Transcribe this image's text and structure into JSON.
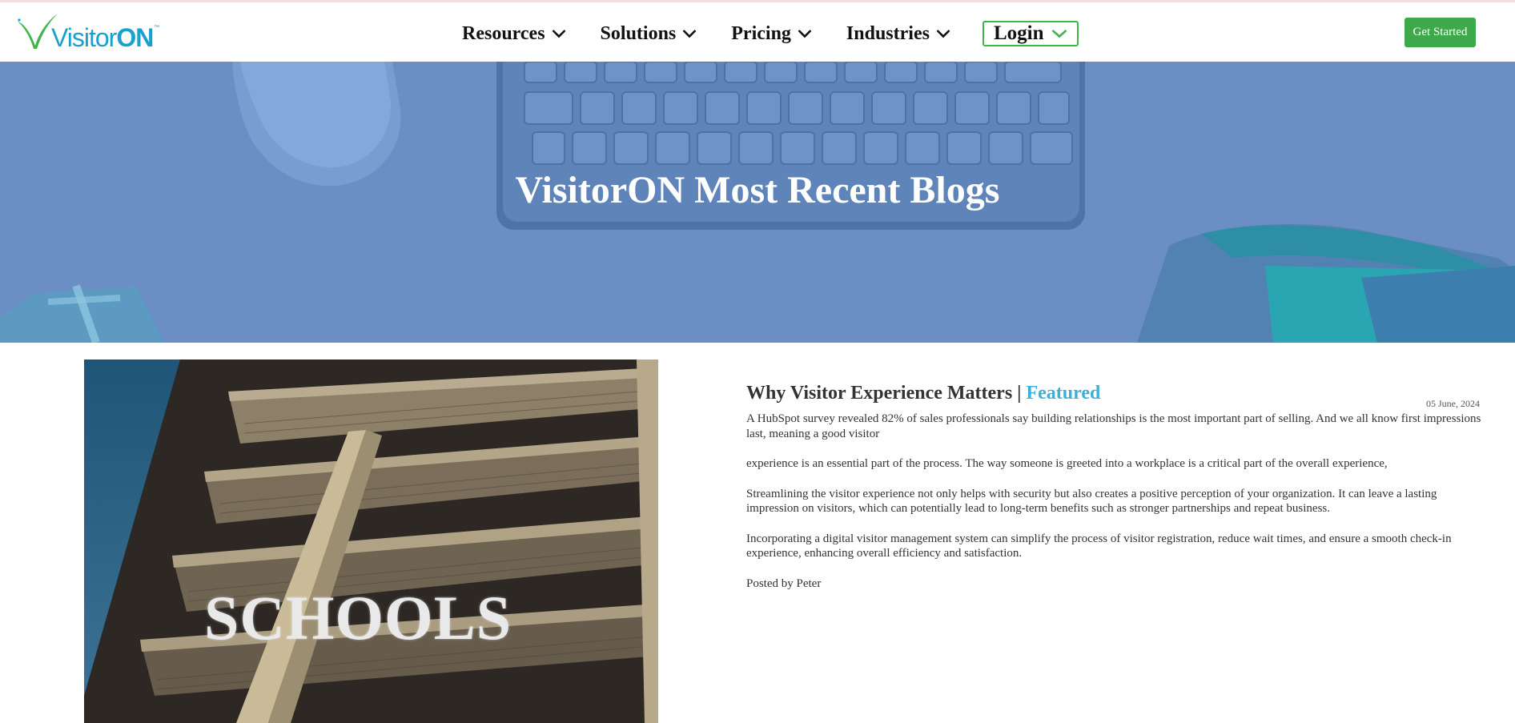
{
  "logo": {
    "brand_visitor": "Visitor",
    "brand_on": "ON",
    "tm": "™"
  },
  "nav": {
    "items": [
      {
        "label": "Resources"
      },
      {
        "label": "Solutions"
      },
      {
        "label": "Pricing"
      },
      {
        "label": "Industries"
      }
    ],
    "login_label": "Login",
    "get_started_label": "Get Started"
  },
  "hero": {
    "title": "VisitorON Most Recent Blogs"
  },
  "post": {
    "image_caption": "SCHOOLS",
    "title": "Why Visitor Experience Matters | ",
    "featured_label": "Featured",
    "date": "05 June, 2024",
    "paragraphs": [
      "A HubSpot survey revealed 82% of sales professionals say building relationships is the most important part of selling. And we all know first impressions last, meaning a good visitor",
      "experience is an essential part of the process. The way someone is greeted into a workplace is a critical part of the overall experience,",
      "Streamlining the visitor experience not only helps with security but also creates a positive perception of your organization. It can leave a lasting impression on visitors, which can potentially lead to long-term benefits such as stronger partnerships and repeat business.",
      "Incorporating a digital visitor management system can simplify the process of visitor registration, reduce wait times, and ensure a smooth check-in experience, enhancing overall efficiency and satisfaction."
    ],
    "author": "Posted by Peter"
  },
  "colors": {
    "brand_blue": "#1aa0cf",
    "brand_green": "#3da94a",
    "hero_blue": "#6a8fc3",
    "featured_blue": "#3bb0d8"
  },
  "icons": [
    "visitoron-logo-icon",
    "chevron-down-icon"
  ]
}
